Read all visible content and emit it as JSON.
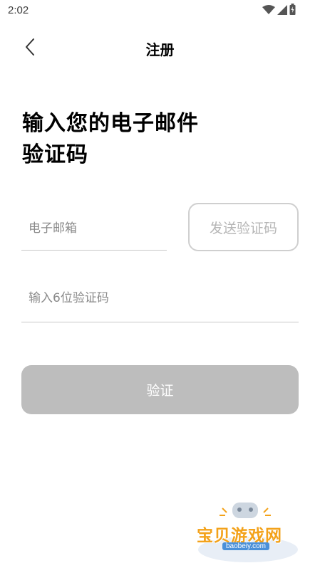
{
  "status_bar": {
    "time": "2:02",
    "icons": [
      "wifi-icon",
      "signal-icon",
      "battery-icon"
    ]
  },
  "nav": {
    "title": "注册",
    "back_icon": "chevron-left-icon"
  },
  "heading": {
    "line1": "输入您的电子邮件",
    "line2": "验证码"
  },
  "form": {
    "email_placeholder": "电子邮箱",
    "email_value": "",
    "send_code_label": "发送验证码",
    "code_placeholder": "输入6位验证码",
    "code_value": "",
    "verify_label": "验证"
  },
  "watermark": {
    "text": "宝贝游戏网",
    "url": "baobeiy.com"
  },
  "colors": {
    "disabled_button": "#bdbdbd",
    "input_underline": "#c8c8c8",
    "placeholder": "#8a8a8a",
    "watermark_orange": "#f3a21a"
  }
}
